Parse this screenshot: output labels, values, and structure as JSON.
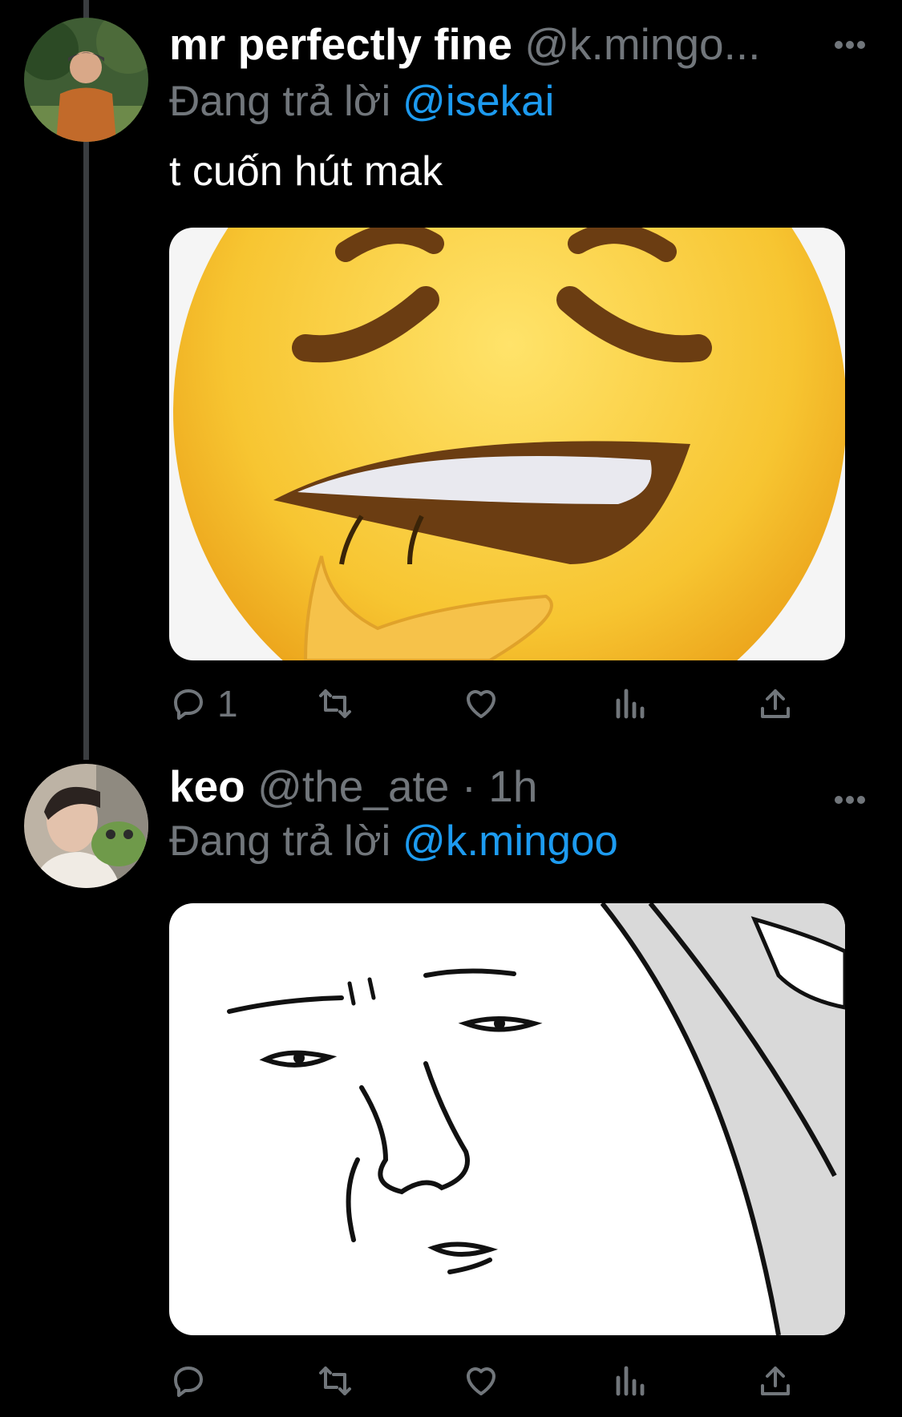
{
  "tweets": [
    {
      "display_name": "mr perfectly fine",
      "handle": "@k.mingo...",
      "reply_prefix": "Đang trả lời",
      "reply_to": "@isekai",
      "text": "t cuốn hút mak",
      "media_icon": "emoji-face-biting-lip",
      "actions": {
        "reply_count": "1",
        "retweet_count": "",
        "like_count": ""
      }
    },
    {
      "display_name": "keo",
      "handle": "@the_ate",
      "time": "· 1h",
      "reply_prefix": "Đang trả lời",
      "reply_to": "@k.mingoo",
      "media_icon": "sketch-face-meme",
      "actions": {
        "reply_count": "",
        "retweet_count": "",
        "like_count": ""
      }
    }
  ],
  "icons": [
    "more-icon",
    "reply-icon",
    "retweet-icon",
    "like-icon",
    "views-icon",
    "share-icon"
  ],
  "colors": {
    "background": "#000000",
    "secondary_text": "#71767b",
    "mention": "#1d9bf0"
  }
}
